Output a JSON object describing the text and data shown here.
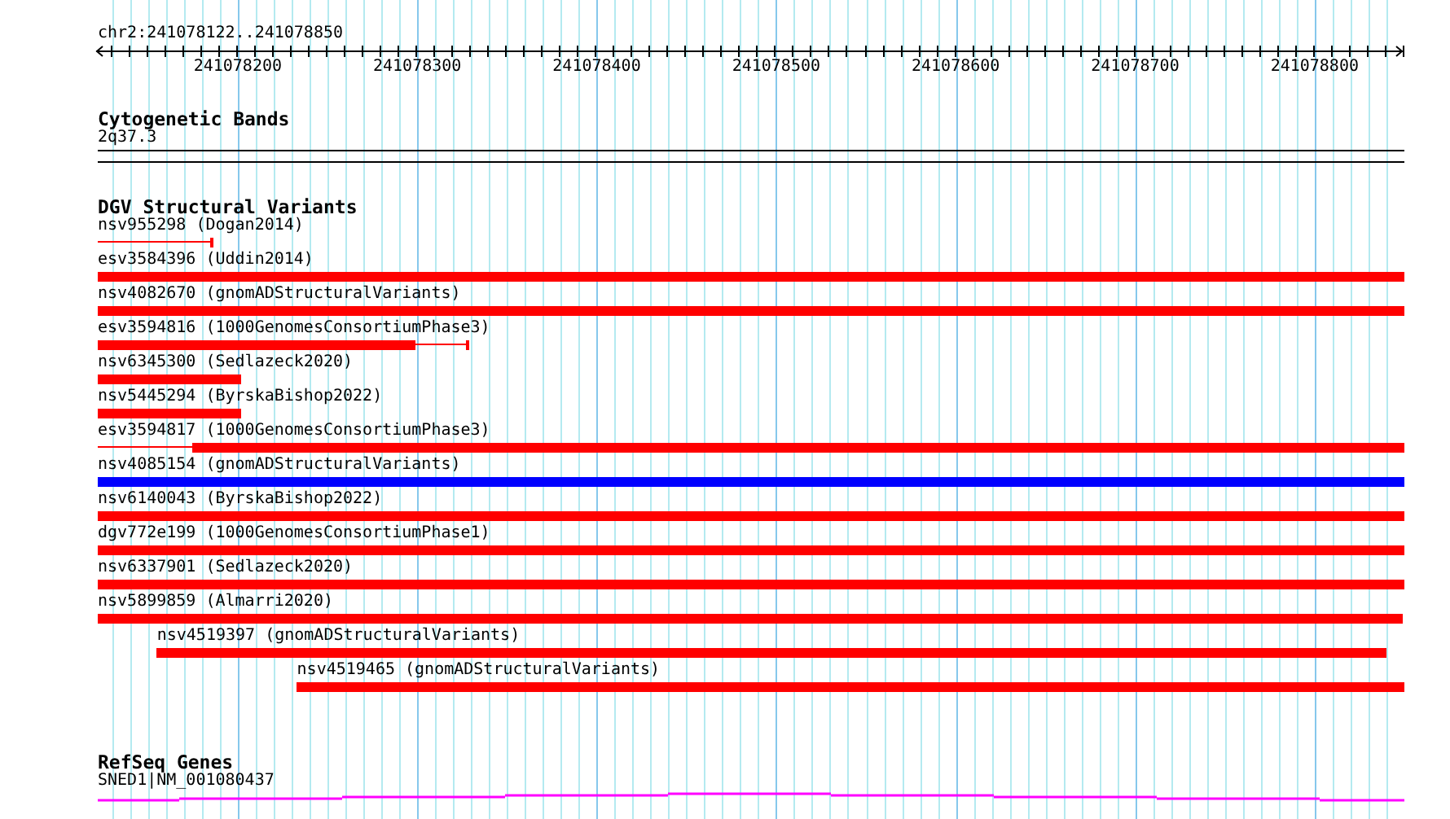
{
  "view": {
    "location": "chr2:241078122..241078850",
    "ticks": [
      "241078200",
      "241078300",
      "241078400",
      "241078500",
      "241078600",
      "241078700",
      "241078800"
    ]
  },
  "tracks": [
    {
      "title": "Cytogenetic Bands",
      "kind": "bands",
      "features": [
        {
          "label": "2q37.3"
        }
      ]
    },
    {
      "title": "DGV Structural Variants",
      "kind": "variants",
      "features": [
        {
          "label": "nsv955298 (Dogan2014)",
          "kind": "line",
          "color": "#ff0000"
        },
        {
          "label": "esv3584396 (Uddin2014)",
          "kind": "block",
          "color": "#ff0000"
        },
        {
          "label": "nsv4082670 (gnomADStructuralVariants)",
          "kind": "block",
          "color": "#ff0000"
        },
        {
          "label": "esv3594816 (1000GenomesConsortiumPhase3)",
          "kind": "line",
          "color": "#ff0000"
        },
        {
          "label": "nsv6345300 (Sedlazeck2020)",
          "kind": "block",
          "color": "#ff0000"
        },
        {
          "label": "nsv5445294 (ByrskaBishop2022)",
          "kind": "block",
          "color": "#ff0000"
        },
        {
          "label": "esv3594817 (1000GenomesConsortiumPhase3)",
          "kind": "line",
          "color": "#ff0000"
        },
        {
          "label": "nsv4085154 (gnomADStructuralVariants)",
          "kind": "block",
          "color": "#0000ff"
        },
        {
          "label": "nsv6140043 (ByrskaBishop2022)",
          "kind": "block",
          "color": "#ff0000"
        },
        {
          "label": "dgv772e199 (1000GenomesConsortiumPhase1)",
          "kind": "block",
          "color": "#ff0000"
        },
        {
          "label": "nsv6337901 (Sedlazeck2020)",
          "kind": "block",
          "color": "#ff0000"
        },
        {
          "label": "nsv5899859 (Almarri2020)",
          "kind": "block",
          "color": "#ff0000"
        },
        {
          "label": "nsv4519397 (gnomADStructuralVariants)",
          "kind": "block",
          "color": "#ff0000"
        },
        {
          "label": "nsv4519465 (gnomADStructuralVariants)",
          "kind": "block",
          "color": "#ff0000"
        }
      ]
    },
    {
      "title": "RefSeq Genes",
      "kind": "genes",
      "features": [
        {
          "label": "SNED1|NM_001080437",
          "color": "#ff00ff"
        }
      ]
    }
  ]
}
